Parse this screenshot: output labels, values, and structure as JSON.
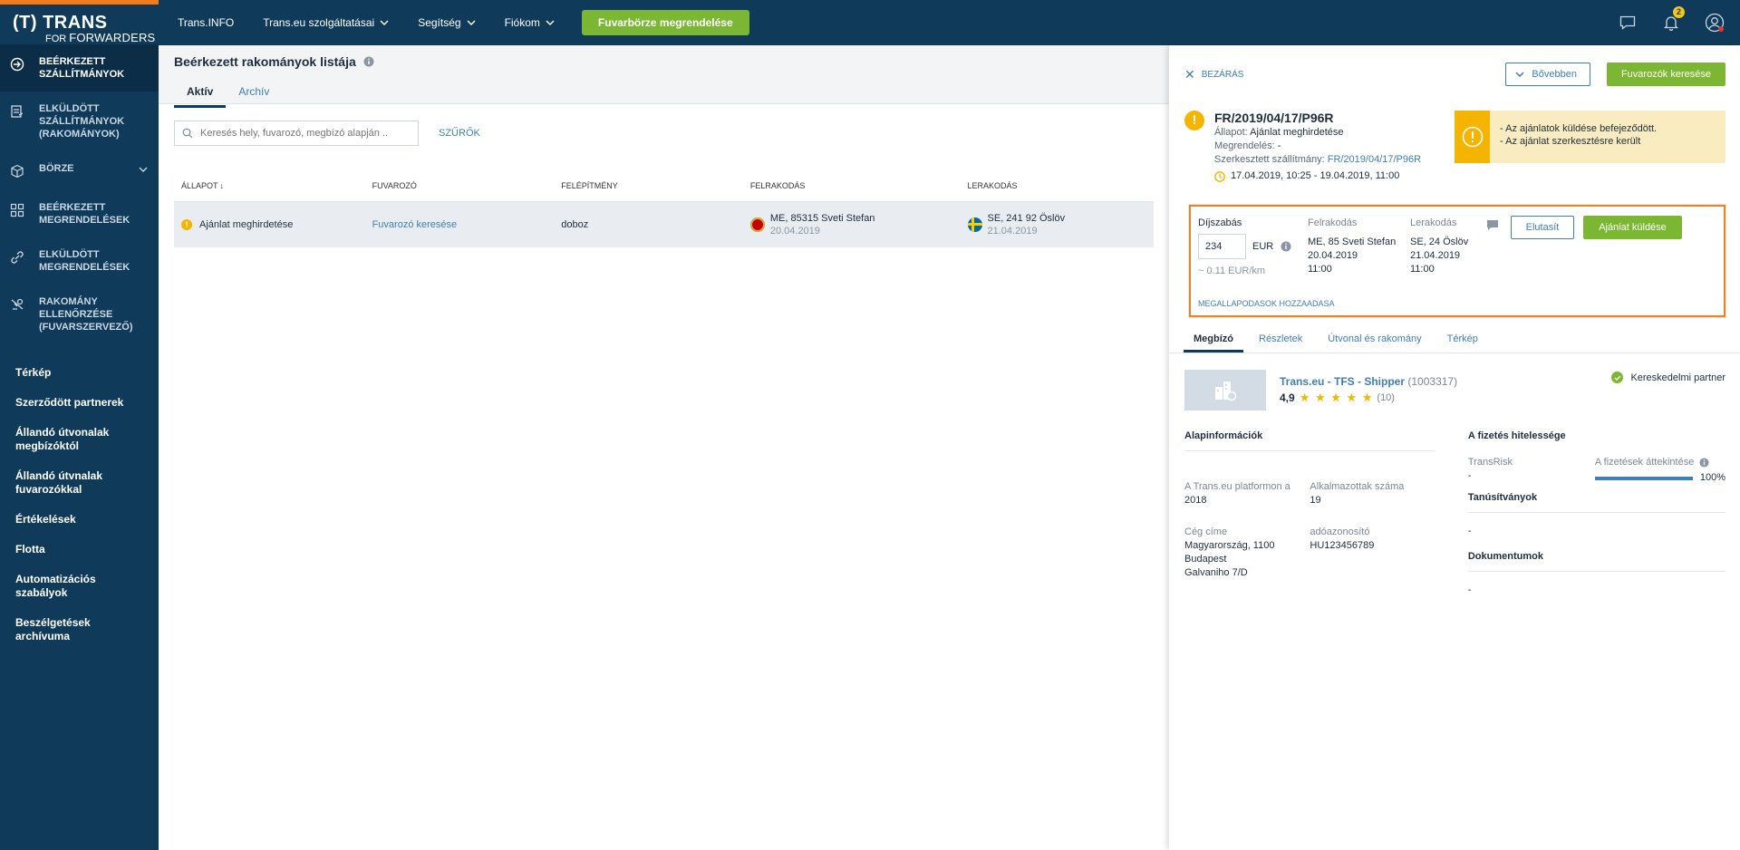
{
  "sidebar": {
    "logo_main": "(T) TRANS",
    "logo_sub_for": "FOR",
    "logo_sub": "FORWARDERS",
    "main_items": [
      {
        "label": "BEÉRKEZETT SZÁLLÍTMÁNYOK",
        "icon": "incoming-shipments-icon"
      },
      {
        "label": "ELKÜLDÖTT SZÁLLÍTMÁNYOK (RAKOMÁNYOK)",
        "icon": "sent-shipments-icon"
      },
      {
        "label": "BÖRZE",
        "icon": "exchange-icon"
      },
      {
        "label": "BEÉRKEZETT MEGRENDELÉSEK",
        "icon": "incoming-orders-icon"
      },
      {
        "label": "ELKÜLDÖTT MEGRENDELÉSEK",
        "icon": "sent-orders-icon"
      },
      {
        "label": "RAKOMÁNY ELLENŐRZÉSE (FUVARSZERVEZŐ)",
        "icon": "load-check-icon"
      }
    ],
    "secondary_items": [
      "Térkép",
      "Szerződött partnerek",
      "Állandó útvonalak megbízóktól",
      "Állandó útvnalak fuvarozókkal",
      "Értékelések",
      "Flotta",
      "Automatizációs szabályok",
      "Beszélgetések archívuma"
    ]
  },
  "topbar": {
    "links": [
      "Trans.INFO",
      "Trans.eu szolgáltatásai",
      "Segítség",
      "Fiókom"
    ],
    "order_button": "Fuvarbörze megrendelése",
    "notification_count": "2"
  },
  "main": {
    "title": "Beérkezett rakományok listája",
    "tabs": [
      "Aktív",
      "Archív"
    ],
    "search_placeholder": "Keresés hely, fuvarozó, megbízó alapján ..",
    "filters_label": "SZŰRŐK",
    "columns": [
      "ÁLLAPOT",
      "FUVAROZÓ",
      "FELÉPÍTMÉNY",
      "FELRAKODÁS",
      "LERAKODÁS"
    ],
    "row": {
      "status": "Ajánlat meghirdetése",
      "carrier": "Fuvarozó keresése",
      "body": "doboz",
      "loading_place": "ME, 85315 Sveti Stefan",
      "loading_date": "20.04.2019",
      "unloading_place": "SE, 241 92 Öslöv",
      "unloading_date": "21.04.2019"
    }
  },
  "panel": {
    "close_label": "BEZÁRÁS",
    "more_button": "Bővebben",
    "find_carriers_button": "Fuvarozók keresése",
    "shipment_number": "FR/2019/04/17/P96R",
    "status_label": "Állapot:",
    "status_value": "Ajánlat meghirdetése",
    "order_label": "Megrendelés:",
    "order_value": "-",
    "edited_label": "Szerkesztett szállítmány:",
    "edited_value": "FR/2019/04/17/P96R",
    "date_range": "17.04.2019, 10:25 - 19.04.2019, 11:00",
    "alert_line1": "- Az ajánlatok küldése befejeződött.",
    "alert_line2": "- Az ajánlat szerkesztésre került",
    "offer": {
      "price_label": "Díjszabás",
      "price_value": "234",
      "currency": "EUR",
      "per_km": "~ 0.11 EUR/km",
      "loading_label": "Felrakodás",
      "loading_place": "ME, 85 Sveti Stefan",
      "loading_date": "20.04.2019",
      "loading_time": "11:00",
      "unloading_label": "Lerakodás",
      "unloading_place": "SE, 24 Öslöv",
      "unloading_date": "21.04.2019",
      "unloading_time": "11:00",
      "agreements_link": "MEGALLAPODASOK HOZZAADASA",
      "reject_button": "Elutasít",
      "send_button": "Ajánlat küldése"
    },
    "tabs": [
      "Megbízó",
      "Részletek",
      "Útvonal és rakomány",
      "Térkép"
    ],
    "shipper": {
      "name": "Trans.eu - TFS - Shipper",
      "id": "(1003317)",
      "rating": "4,9",
      "stars": "★ ★ ★ ★ ★",
      "reviews": "(10)",
      "partner_label": "Kereskedelmi partner"
    },
    "basic_info": {
      "title": "Alapinformációk",
      "since_label": "A Trans.eu platformon a",
      "since_value": "2018",
      "employees_label": "Alkalmazottak száma",
      "employees_value": "19",
      "address_label": "Cég címe",
      "address_line1": "Magyarország, 1100 Budapest",
      "address_line2": "Galvaniho 7/D",
      "tax_label": "adóazonosító",
      "tax_value": "HU123456789"
    },
    "credit": {
      "title": "A fizetés hitelessége",
      "transrisk_label": "TransRisk",
      "transrisk_value": "-",
      "payments_label": "A fizetések áttekintése",
      "payments_value": "100%",
      "payments_fraction": 1.0,
      "certs_title": "Tanúsítványok",
      "certs_value": "-",
      "docs_title": "Dokumentumok",
      "docs_value": "-"
    }
  },
  "colors": {
    "sidebar_bg": "#0f3a5a",
    "accent_green": "#7cb733",
    "accent_orange": "#e8822b",
    "warning_yellow": "#f5b400",
    "link_blue": "#3e7fb5"
  }
}
